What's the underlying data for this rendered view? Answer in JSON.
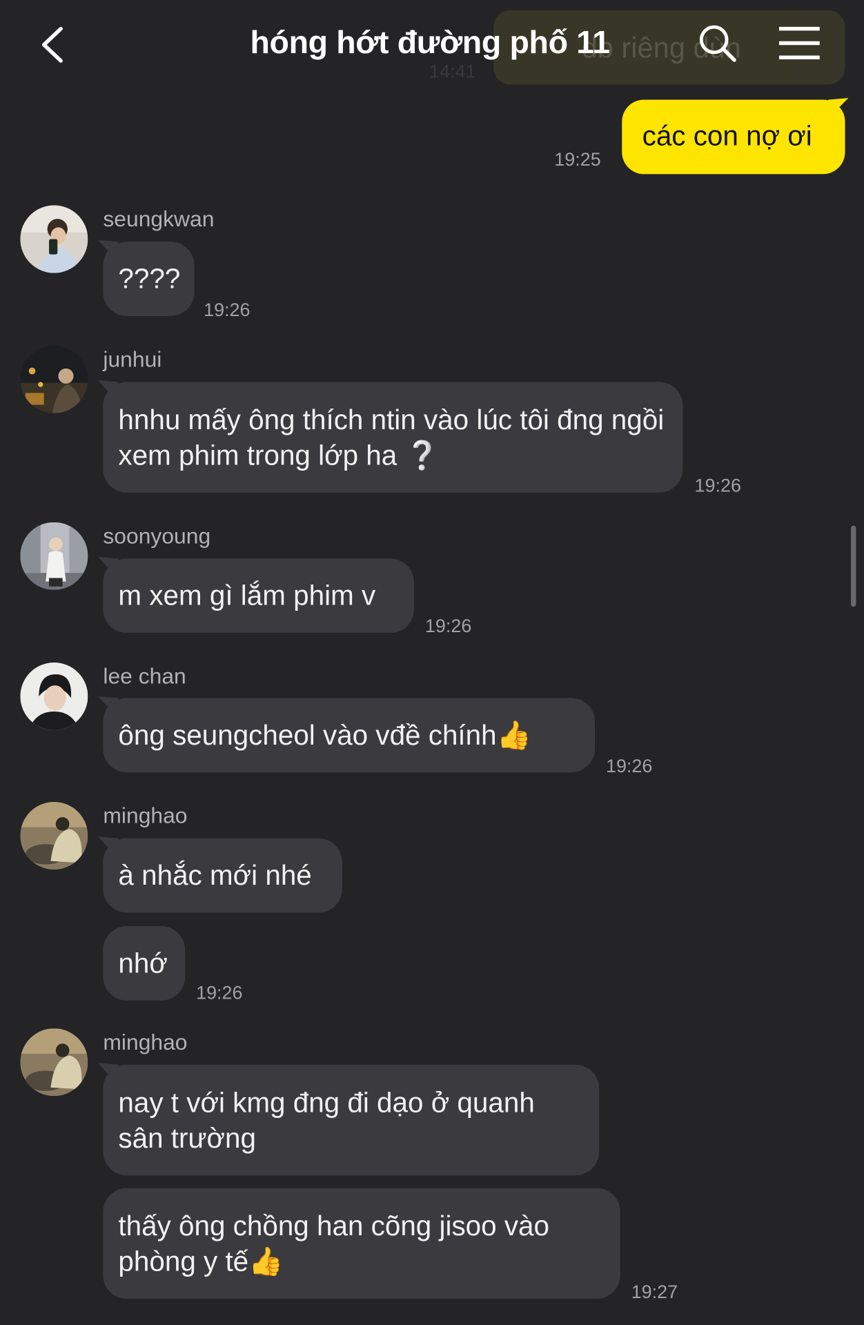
{
  "header": {
    "title": "hóng hớt đường phố 11",
    "ghost_text": "db riêng dùn",
    "ghost_time": "14:41"
  },
  "my_message": {
    "text": "các con nợ ơi",
    "time": "19:25"
  },
  "messages": [
    {
      "sender": "seungkwan",
      "texts": [
        "????"
      ],
      "time": "19:26"
    },
    {
      "sender": "junhui",
      "texts": [
        "hnhu mấy ông thích ntin vào lúc tôi đng ngồi xem phim trong lớp ha ❔"
      ],
      "time": "19:26"
    },
    {
      "sender": "soonyoung",
      "texts": [
        "m xem gì lắm phim v"
      ],
      "time": "19:26"
    },
    {
      "sender": "lee chan",
      "texts": [
        "ông seungcheol vào vđề chính👍"
      ],
      "time": "19:26"
    },
    {
      "sender": "minghao",
      "texts": [
        "à nhắc mới nhé",
        "nhớ"
      ],
      "time": "19:26"
    },
    {
      "sender": "minghao",
      "texts": [
        "nay t với kmg đng đi dạo ở quanh sân trường",
        "thấy ông chồng han cõng jisoo vào phòng y tế👍"
      ],
      "time": "19:27"
    }
  ],
  "icons": {
    "back": "chevron-left-icon",
    "search": "search-icon",
    "menu": "hamburger-menu-icon"
  },
  "colors": {
    "background": "#242427",
    "my_bubble": "#fee500",
    "other_bubble": "#3b3b3f",
    "timestamp": "#a2a2a6"
  }
}
